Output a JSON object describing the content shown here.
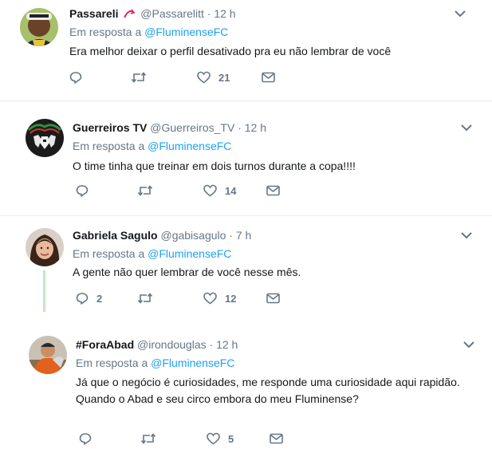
{
  "tweets": [
    {
      "name": "Passareli",
      "handle": "@Passarelitt",
      "separator": "·",
      "time": "12 h",
      "reply_prefix": "Em resposta a",
      "reply_to": "@FluminenseFC",
      "text_lines": [
        "Era melhor deixar o perfil desativado pra eu não lembrar de você"
      ],
      "replies": "",
      "retweets": "",
      "likes": "21"
    },
    {
      "name": "Guerreiros TV",
      "handle": "@Guerreiros_TV",
      "separator": "·",
      "time": "12 h",
      "reply_prefix": "Em resposta a",
      "reply_to": "@FluminenseFC",
      "text_lines": [
        "O time tinha que treinar em dois turnos durante a copa!!!!"
      ],
      "replies": "",
      "retweets": "",
      "likes": "14"
    },
    {
      "name": "Gabriela Sagulo",
      "handle": "@gabisagulo",
      "separator": "·",
      "time": "7 h",
      "reply_prefix": "Em resposta a",
      "reply_to": "@FluminenseFC",
      "text_lines": [
        "A gente não quer lembrar de você nesse mês."
      ],
      "replies": "2",
      "retweets": "",
      "likes": "12"
    },
    {
      "name": "#ForaAbad",
      "handle": "@irondouglas",
      "separator": "·",
      "time": "12 h",
      "reply_prefix": "Em resposta a",
      "reply_to": "@FluminenseFC",
      "text_lines": [
        "Já que o negócio é curiosidades, me responde uma curiosidade aqui rapidão.",
        "Quando o Abad e seu circo embora do meu Fluminense?"
      ],
      "replies": "",
      "retweets": "",
      "likes": "5"
    }
  ],
  "colors": {
    "link": "#1da1f2",
    "secondary": "#657786",
    "divider": "#e6ecf0",
    "thread_line": "#c6e6c8"
  },
  "icons": {
    "reply": "reply-icon",
    "retweet": "retweet-icon",
    "like": "heart-icon",
    "dm": "envelope-icon",
    "menu": "chevron-down-icon"
  }
}
